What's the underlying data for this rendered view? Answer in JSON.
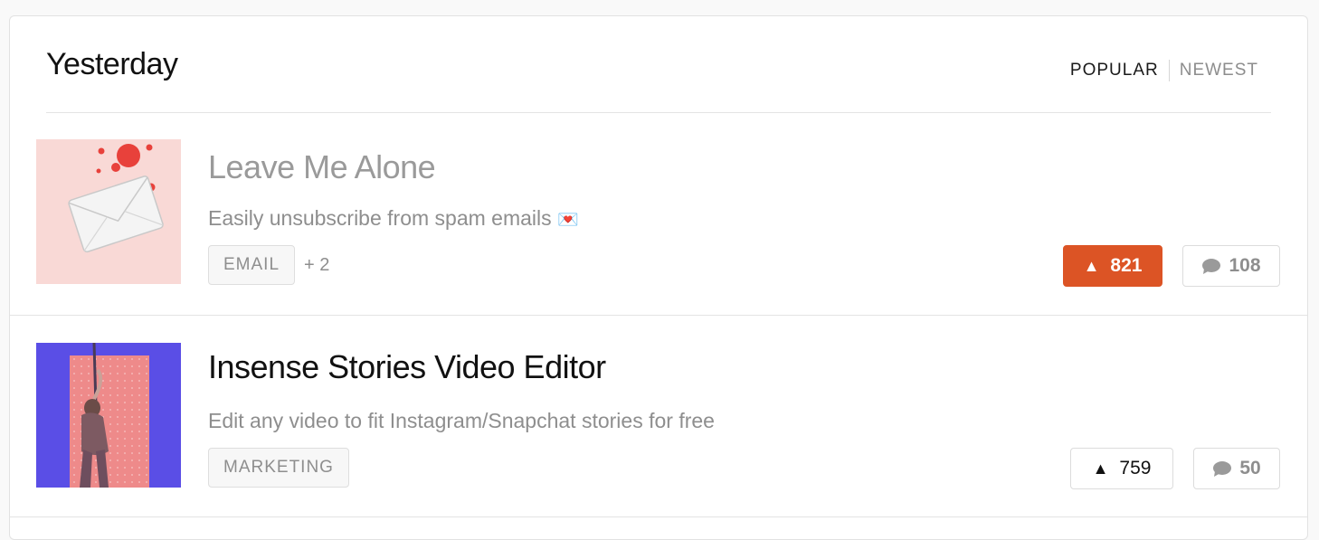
{
  "section": {
    "title": "Yesterday",
    "sort_tabs": [
      {
        "label": "POPULAR",
        "active": true
      },
      {
        "label": "NEWEST",
        "active": false
      }
    ]
  },
  "posts": [
    {
      "title": "Leave Me Alone",
      "tagline": "Easily unsubscribe from spam emails",
      "tagline_emoji": "💌",
      "tag": "EMAIL",
      "more_tags": "+ 2",
      "votes": "821",
      "upvoted": true,
      "comments": "108",
      "thumbnail_icon": "envelope-icon",
      "thumbnail_bg": "#f9d9d6"
    },
    {
      "title": "Insense Stories Video Editor",
      "tagline": "Edit any video to fit Instagram/Snapchat stories for free",
      "tag": "MARKETING",
      "votes": "759",
      "upvoted": false,
      "comments": "50",
      "thumbnail_icon": "person-photo-icon",
      "thumbnail_bg": "#5a4ee6"
    }
  ],
  "colors": {
    "upvote_accent": "#dc5425",
    "muted_text": "#8e8e8e",
    "border": "#dcdcdc"
  }
}
